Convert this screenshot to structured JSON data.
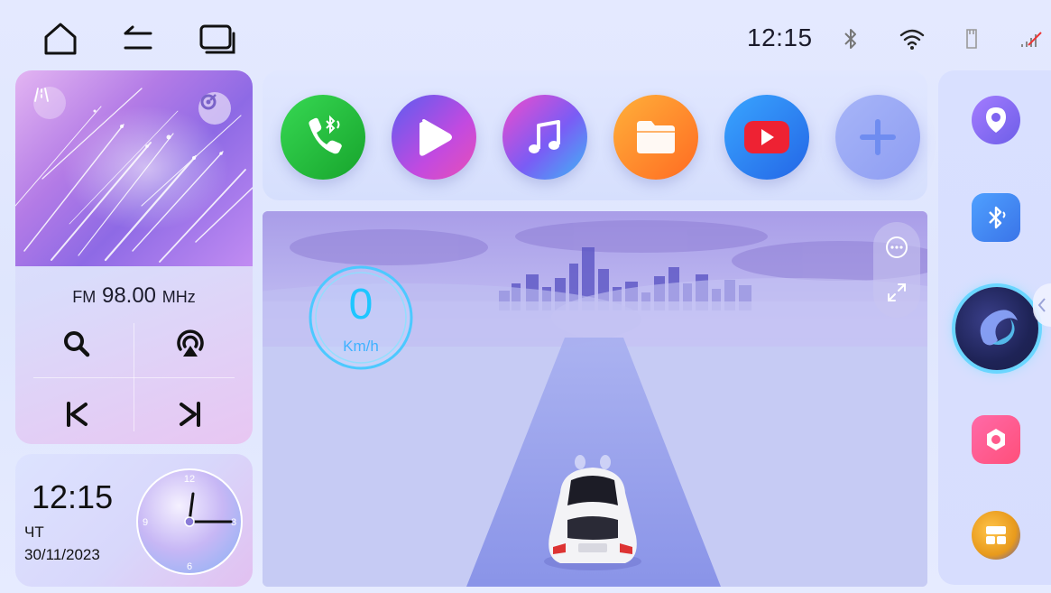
{
  "status_bar": {
    "time": "12:15",
    "nav": [
      "home-icon",
      "back-icon",
      "recents-icon"
    ],
    "icons": [
      "bluetooth-icon",
      "wifi-icon",
      "sd-card-icon",
      "no-signal-icon"
    ]
  },
  "radio": {
    "band": "FM",
    "frequency": "98.00",
    "unit": "MHz"
  },
  "clock": {
    "time": "12:15",
    "day": "ЧТ",
    "date": "30/11/2023",
    "dial_labels": [
      "12",
      "3",
      "6",
      "9"
    ]
  },
  "dock": {
    "apps": [
      "bluetooth-phone-icon",
      "video-player-icon",
      "music-icon",
      "file-manager-icon",
      "youtube-icon",
      "add-app-icon"
    ]
  },
  "drive": {
    "speed": "0",
    "speed_unit": "Km/h"
  },
  "quickbar": {
    "items": [
      "navigation-icon",
      "bluetooth-settings-icon",
      "voice-assistant-icon",
      "settings-icon",
      "split-screen-icon"
    ]
  },
  "colors": {
    "phone": "#22c13a",
    "video": "#7c4be6",
    "music": "#6f5cf2",
    "files": "#ff8a2a",
    "youtube": "#2d7ff0",
    "speed": "#1ec6ff"
  }
}
